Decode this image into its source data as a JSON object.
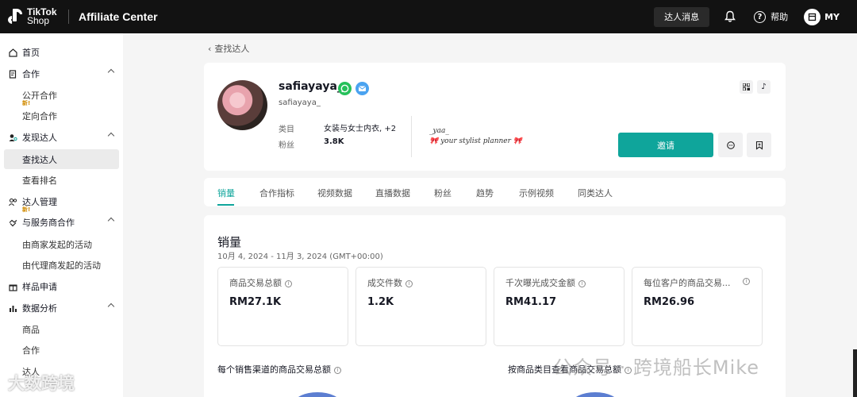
{
  "topbar": {
    "logo_line1": "TikTok",
    "logo_line2": "Shop",
    "app_title": "Affiliate Center",
    "messages_label": "达人消息",
    "help_label": "帮助",
    "user_label": "MY"
  },
  "sidebar": {
    "home": "首页",
    "cooperation": "合作",
    "open_coop": "公开合作",
    "new_badge": "新!",
    "targeted_coop": "定向合作",
    "discover": "发现达人",
    "find_creators": "查找达人",
    "ranking": "查看排名",
    "creator_mgmt": "达人管理",
    "service_coop": "与服务商合作",
    "merchant_campaigns": "由商家发起的活动",
    "agency_campaigns": "由代理商发起的活动",
    "samples": "样品申请",
    "analytics": "数据分析",
    "products": "商品",
    "coop_item": "合作",
    "creators_item": "达人"
  },
  "breadcrumb": {
    "back_label": "查找达人"
  },
  "profile": {
    "name": "safiayaya_",
    "handle": "safiayaya_",
    "category_label": "类目",
    "category_value": "女装与女士内衣, +2",
    "followers_label": "粉丝",
    "followers_value": "3.8K",
    "bio_line1": "_yaa_",
    "bio_line2": "🎀 your stylist planner 🎀",
    "invite_label": "邀请"
  },
  "tabs": [
    "销量",
    "合作指标",
    "视频数据",
    "直播数据",
    "粉丝",
    "趋势",
    "示例视频",
    "同类达人"
  ],
  "sales": {
    "title": "销量",
    "date_range": "10月 4, 2024 - 11月 3, 2024 (GMT+00:00)",
    "metrics": [
      {
        "label": "商品交易总额",
        "value": "RM27.1K"
      },
      {
        "label": "成交件数",
        "value": "1.2K"
      },
      {
        "label": "千次曝光成交金额",
        "value": "RM41.17"
      },
      {
        "label": "每位客户的商品交易...",
        "value": "RM26.96"
      }
    ],
    "channel_title": "每个销售渠道的商品交易总额",
    "category_title": "按商品类目查看商品交易总额"
  },
  "watermarks": {
    "right": "公众号 · 跨境船长Mike",
    "left": "大数跨境"
  },
  "colors": {
    "accent": "#0FA59B",
    "topbar": "#121212"
  }
}
